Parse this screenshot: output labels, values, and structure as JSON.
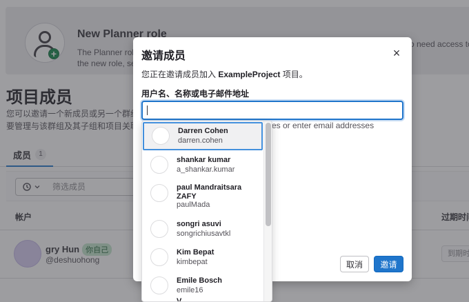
{
  "banner": {
    "title": "New Planner role",
    "text_line1": "The Planner role",
    "text_line2": "the new role, see",
    "text_right": "o need access to"
  },
  "page": {
    "title": "项目成员",
    "desc_line1": "您可以邀请一个新成员或另一个群组加",
    "desc_line2": "要管理与该群组及其子组和项目关联的"
  },
  "tabs": [
    {
      "label": "成员",
      "count": "1"
    }
  ],
  "filter": {
    "placeholder": "筛选成员"
  },
  "table": {
    "headers": {
      "account": "帐户",
      "expiration": "过期时间"
    },
    "rows": [
      {
        "name": "gry Hun",
        "badge": "你自己",
        "handle": "@deshuohong",
        "date_placeholder": "到期时间"
      }
    ]
  },
  "modal": {
    "title": "邀请成员",
    "close_symbol": "×",
    "intro_prefix": "您正在邀请成员加入 ",
    "intro_project": "ExampleProject",
    "intro_suffix": " 项目。",
    "field_label": "用户名、名称或电子邮件地址",
    "field_value": "",
    "hint_visible": "es or enter email addresses",
    "cancel_label": "取消",
    "invite_label": "邀请"
  },
  "dropdown": {
    "items": [
      {
        "name": "Darren Cohen",
        "handle": "darren.cohen",
        "active": true
      },
      {
        "name": "shankar kumar",
        "handle": "a_shankar.kumar",
        "active": false
      },
      {
        "name": "paul Mandraitsara ZAFY",
        "handle": "paulMada",
        "active": false
      },
      {
        "name": "songri asuvi",
        "handle": "songrichiusavtkl",
        "active": false
      },
      {
        "name": "Kim Bepat",
        "handle": "kimbepat",
        "active": false
      },
      {
        "name": "Emile Bosch",
        "handle": "emile16",
        "active": false
      }
    ],
    "partial_next": "V"
  }
}
